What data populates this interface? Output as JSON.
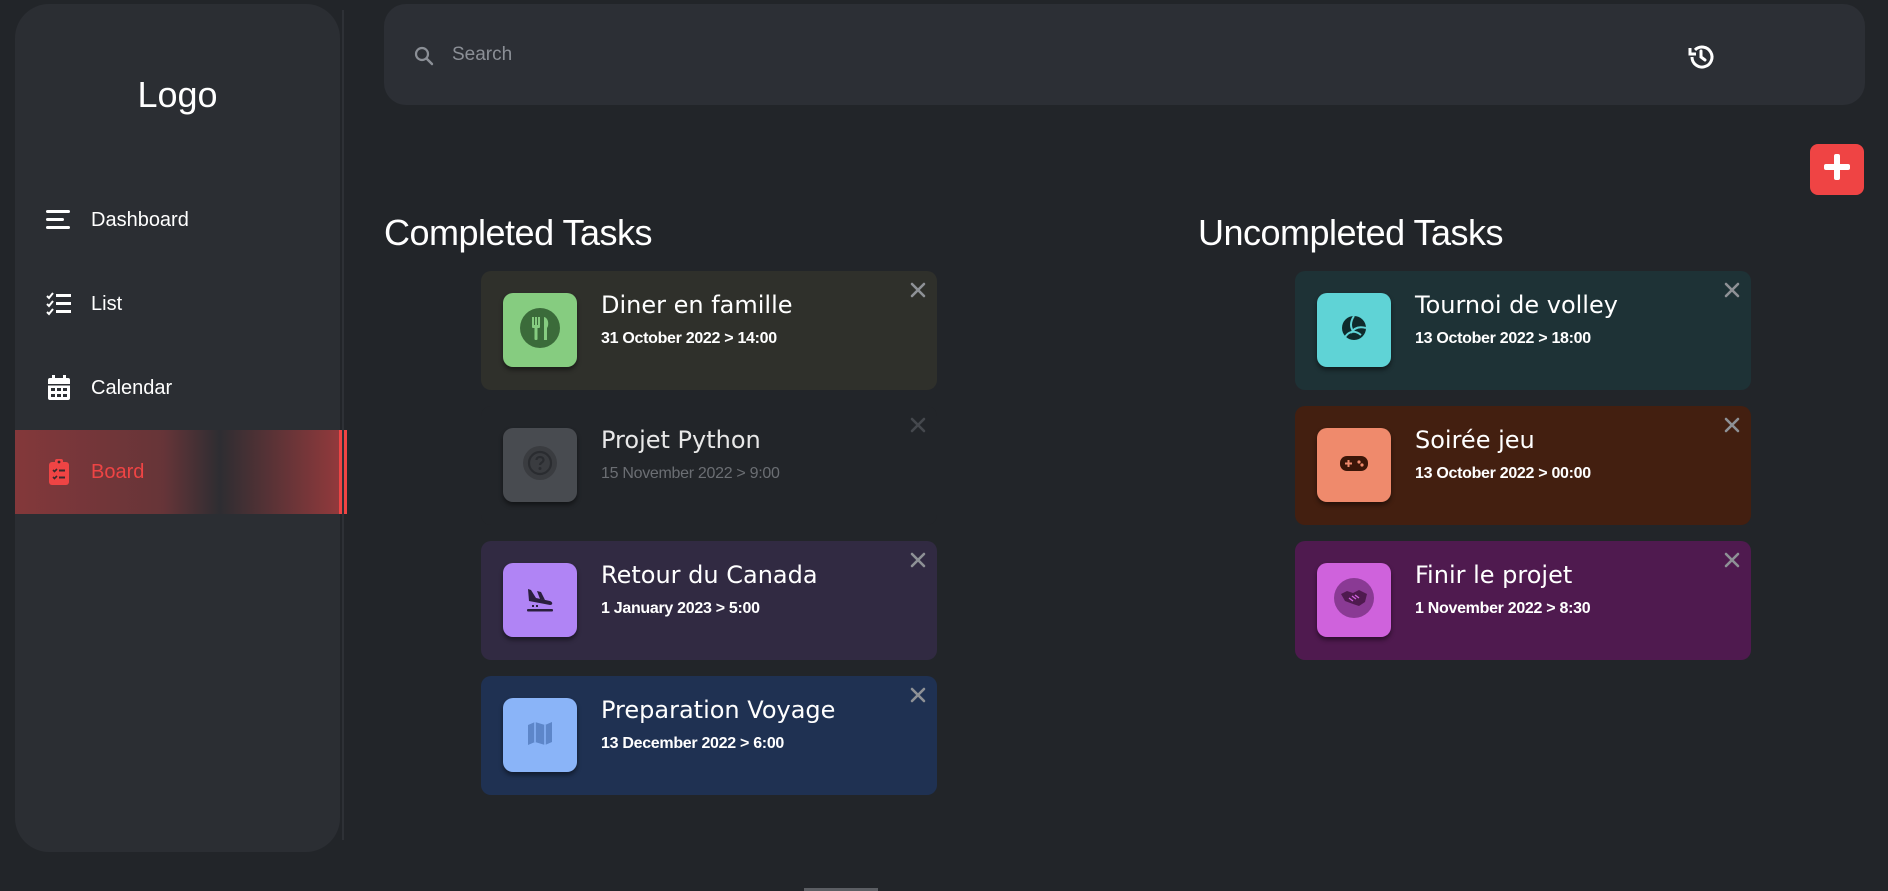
{
  "sidebar": {
    "logo": "Logo",
    "items": [
      {
        "label": "Dashboard",
        "icon": "menu-icon"
      },
      {
        "label": "List",
        "icon": "checklist-icon"
      },
      {
        "label": "Calendar",
        "icon": "calendar-icon"
      },
      {
        "label": "Board",
        "icon": "clipboard-icon",
        "active": true
      }
    ]
  },
  "search": {
    "placeholder": "Search",
    "value": ""
  },
  "header": {
    "history_icon": "history-icon",
    "add_icon": "plus-icon"
  },
  "completed": {
    "title": "Completed Tasks",
    "tasks": [
      {
        "title": "Diner en famille",
        "date": "31 October 2022 > 14:00",
        "icon": "utensils-icon",
        "bg": "#2f302b",
        "tile": "#86cc80"
      },
      {
        "title": "Projet Python",
        "date": "15 November 2022 > 9:00",
        "icon": "question-icon",
        "bg": "#222529",
        "tile": "#484b50"
      },
      {
        "title": "Retour du Canada",
        "date": "1 January 2023 > 5:00",
        "icon": "plane-landing-icon",
        "bg": "#312a42",
        "tile": "#b084f5"
      },
      {
        "title": "Preparation Voyage",
        "date": "13 December 2022 > 6:00",
        "icon": "map-icon",
        "bg": "#1f3152",
        "tile": "#8ab4f8"
      }
    ]
  },
  "uncompleted": {
    "title": "Uncompleted Tasks",
    "tasks": [
      {
        "title": "Tournoi de volley",
        "date": "13 October 2022 > 18:00",
        "icon": "volleyball-icon",
        "bg": "#1e3236",
        "tile": "#5fd3d6"
      },
      {
        "title": "Soirée jeu",
        "date": "13 October 2022 > 00:00",
        "icon": "gamepad-icon",
        "bg": "#431f10",
        "tile": "#ef8a6c"
      },
      {
        "title": "Finir le projet",
        "date": "1 November 2022 > 8:30",
        "icon": "handshake-icon",
        "bg": "#4f1a4f",
        "tile": "#cf62dc"
      }
    ]
  },
  "colors": {
    "accent": "#ef4444",
    "background": "#222529",
    "panel": "#2b2e33"
  }
}
